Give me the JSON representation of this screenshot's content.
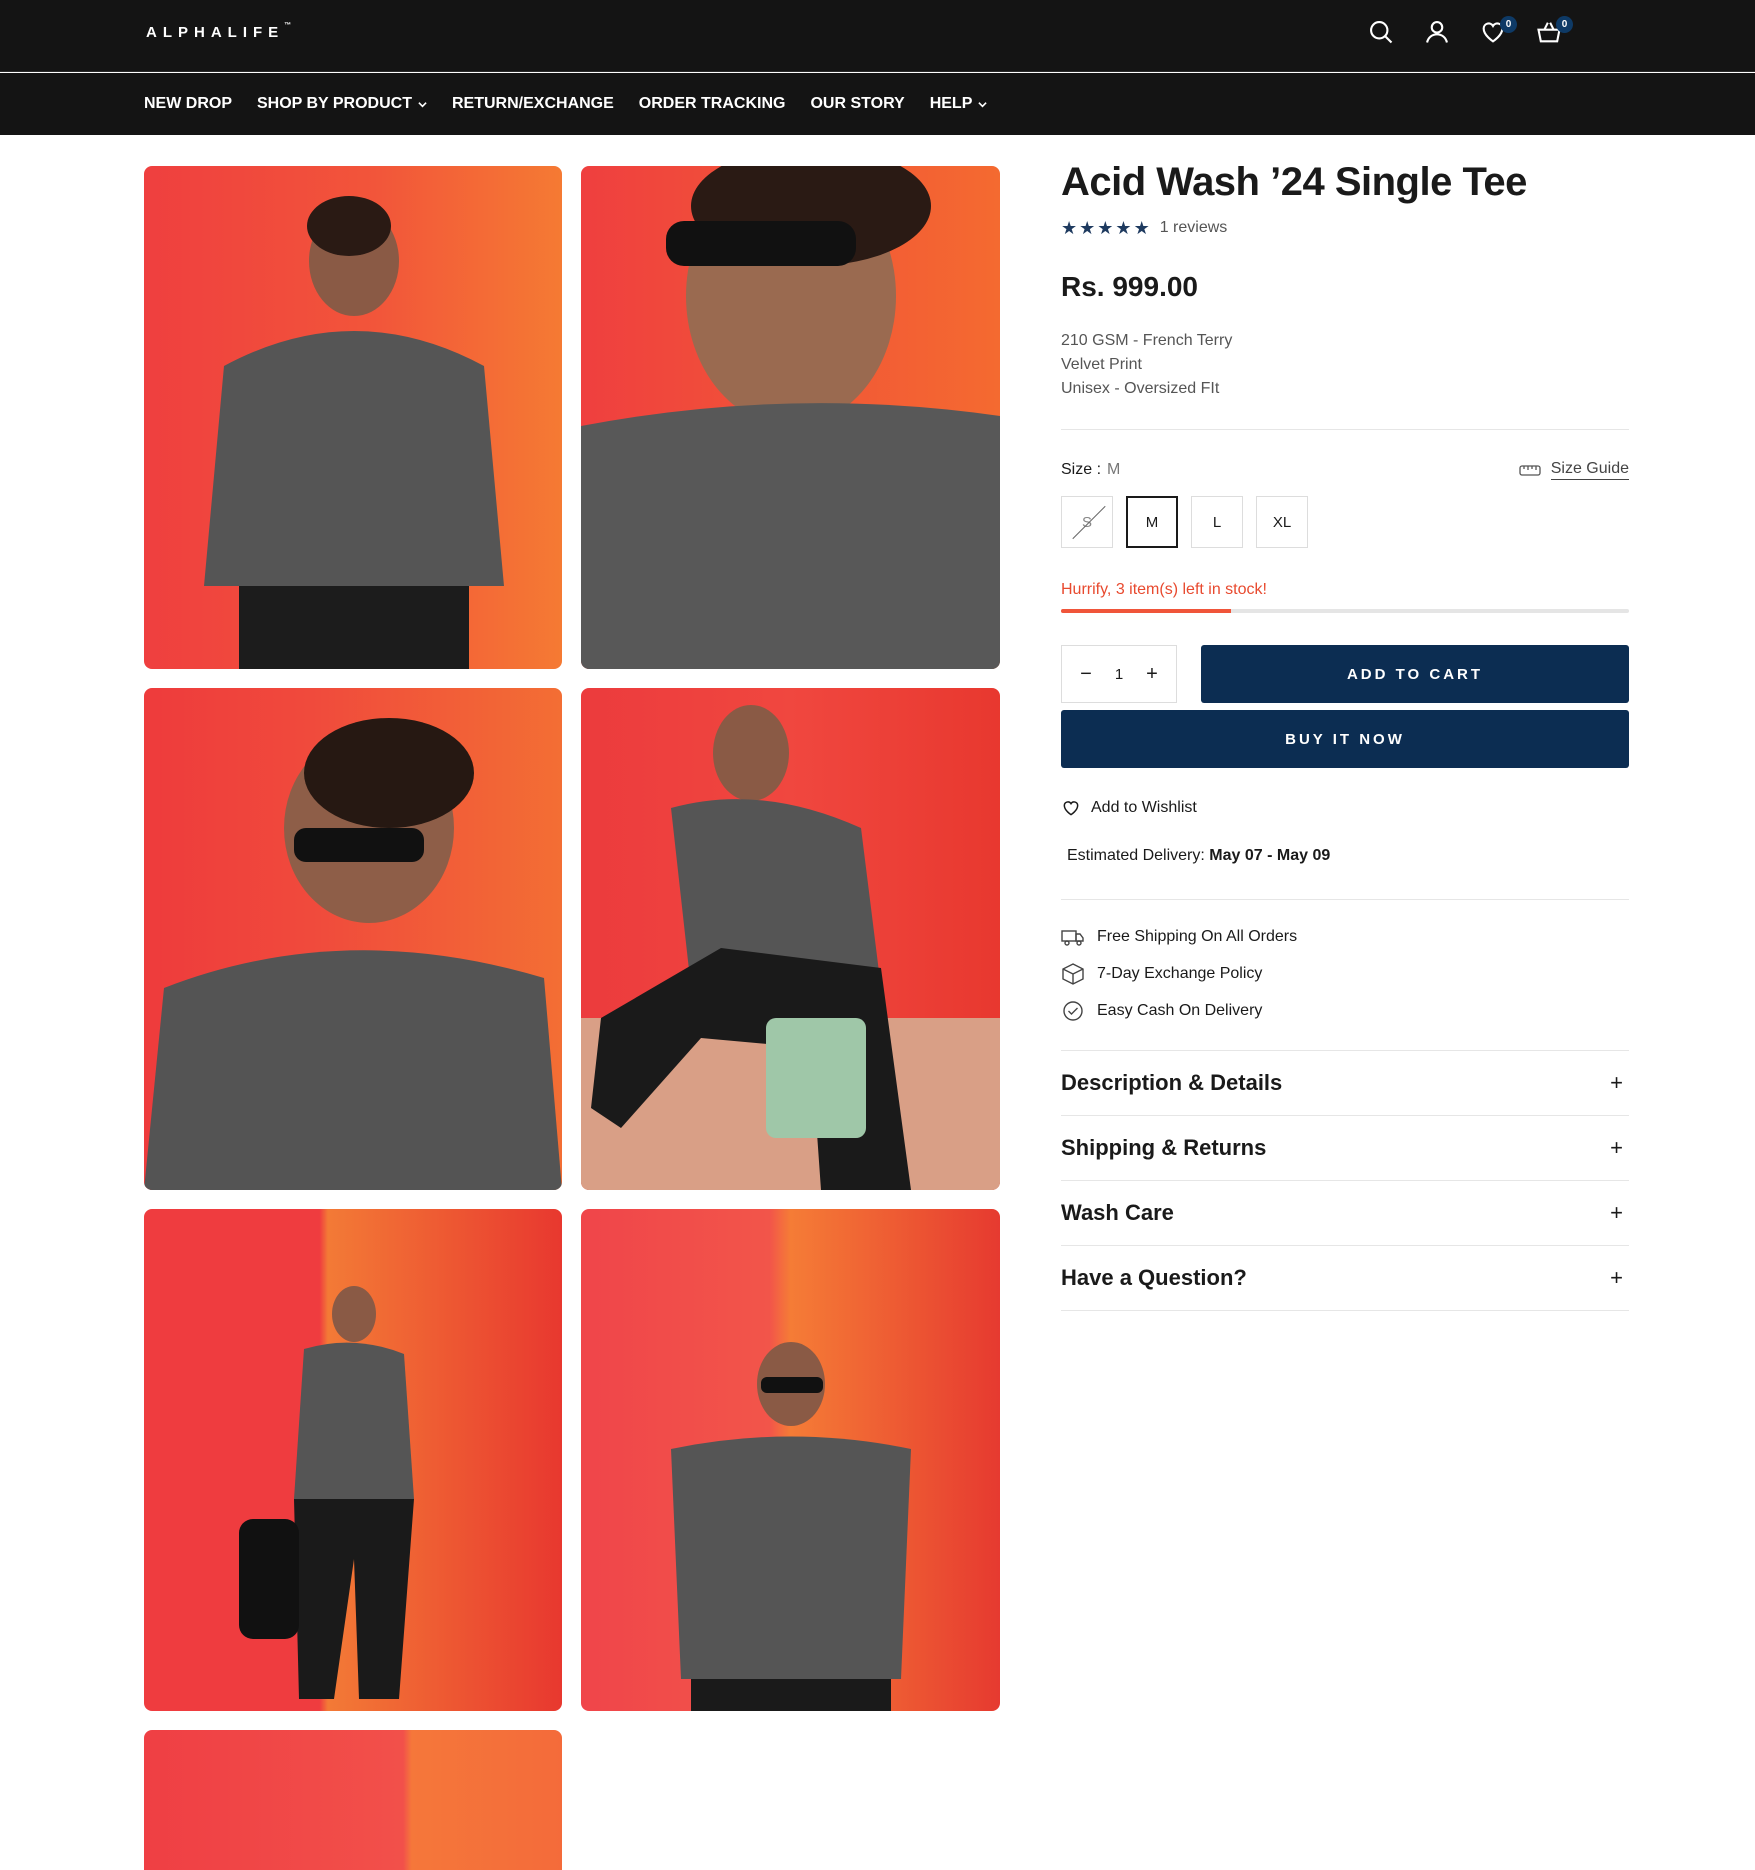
{
  "header": {
    "logo": "ALPHALIFE",
    "logo_tm": "™",
    "wishlist_count": "0",
    "cart_count": "0",
    "nav": [
      {
        "label": "NEW DROP"
      },
      {
        "label": "SHOP BY PRODUCT"
      },
      {
        "label": "RETURN/EXCHANGE"
      },
      {
        "label": "ORDER TRACKING"
      },
      {
        "label": "OUR STORY"
      },
      {
        "label": "HELP"
      }
    ]
  },
  "product": {
    "title": "Acid Wash ’24 Single Tee",
    "rating": 5,
    "reviews": "1 reviews",
    "price": "Rs. 999.00",
    "specs": [
      "210 GSM - French Terry",
      "Velvet Print",
      "Unisex - Oversized FIt"
    ],
    "size_label": "Size :",
    "size_selected": "M",
    "size_guide": "Size Guide",
    "sizes": [
      "S",
      "M",
      "L",
      "XL"
    ],
    "stock_text": "Hurrify, 3 item(s) left in stock!",
    "stock_fraction": 0.3,
    "quantity": "1",
    "add_to_cart": "ADD TO CART",
    "buy_now": "BUY IT NOW",
    "wishlist": "Add to Wishlist",
    "delivery_label": "Estimated Delivery:",
    "delivery_value": "May 07 - May 09",
    "perks": [
      "Free Shipping On All Orders",
      "7-Day Exchange Policy",
      "Easy Cash On Delivery"
    ],
    "accordion": [
      "Description & Details",
      "Shipping & Returns",
      "Wash Care",
      "Have a Question?"
    ]
  },
  "colors": {
    "header_bg": "#141414",
    "accent_navy": "#0c2d52",
    "stock_red": "#e84a2f",
    "backdrop_red": "#f0453f",
    "backdrop_orange": "#f26a34"
  }
}
